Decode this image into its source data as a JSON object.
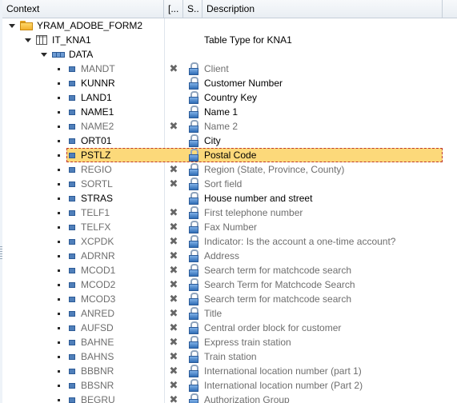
{
  "header": {
    "context": "Context",
    "col1": "[...",
    "col2": "S..",
    "description": "Description"
  },
  "tree": {
    "root": {
      "label": "YRAM_ADOBE_FORM2"
    },
    "table": {
      "label": "IT_KNA1",
      "description": "Table Type for KNA1"
    },
    "structure": {
      "label": "DATA"
    }
  },
  "fields": [
    {
      "name": "MANDT",
      "desc": "Client",
      "inactive": true
    },
    {
      "name": "KUNNR",
      "desc": "Customer Number",
      "inactive": false
    },
    {
      "name": "LAND1",
      "desc": "Country Key",
      "inactive": false
    },
    {
      "name": "NAME1",
      "desc": "Name 1",
      "inactive": false
    },
    {
      "name": "NAME2",
      "desc": "Name 2",
      "inactive": true
    },
    {
      "name": "ORT01",
      "desc": "City",
      "inactive": false
    },
    {
      "name": "PSTLZ",
      "desc": "Postal Code",
      "inactive": false,
      "selected": true
    },
    {
      "name": "REGIO",
      "desc": "Region (State, Province, County)",
      "inactive": true
    },
    {
      "name": "SORTL",
      "desc": "Sort field",
      "inactive": true
    },
    {
      "name": "STRAS",
      "desc": "House number and street",
      "inactive": false
    },
    {
      "name": "TELF1",
      "desc": "First telephone number",
      "inactive": true
    },
    {
      "name": "TELFX",
      "desc": "Fax Number",
      "inactive": true
    },
    {
      "name": "XCPDK",
      "desc": "Indicator: Is the account a one-time account?",
      "inactive": true
    },
    {
      "name": "ADRNR",
      "desc": "Address",
      "inactive": true
    },
    {
      "name": "MCOD1",
      "desc": "Search term for matchcode search",
      "inactive": true
    },
    {
      "name": "MCOD2",
      "desc": "Search Term for Matchcode Search",
      "inactive": true
    },
    {
      "name": "MCOD3",
      "desc": "Search term for matchcode search",
      "inactive": true
    },
    {
      "name": "ANRED",
      "desc": "Title",
      "inactive": true
    },
    {
      "name": "AUFSD",
      "desc": "Central order block for customer",
      "inactive": true
    },
    {
      "name": "BAHNE",
      "desc": "Express train station",
      "inactive": true
    },
    {
      "name": "BAHNS",
      "desc": "Train station",
      "inactive": true
    },
    {
      "name": "BBBNR",
      "desc": "International location number  (part 1)",
      "inactive": true
    },
    {
      "name": "BBSNR",
      "desc": "International location number (Part 2)",
      "inactive": true
    },
    {
      "name": "BEGRU",
      "desc": "Authorization Group",
      "inactive": true
    }
  ],
  "colors": {
    "selection_fill": "#fcd97a",
    "selection_border": "#c0392b",
    "inactive_text": "#6e6e6e",
    "field_icon": "#4f7fba"
  }
}
